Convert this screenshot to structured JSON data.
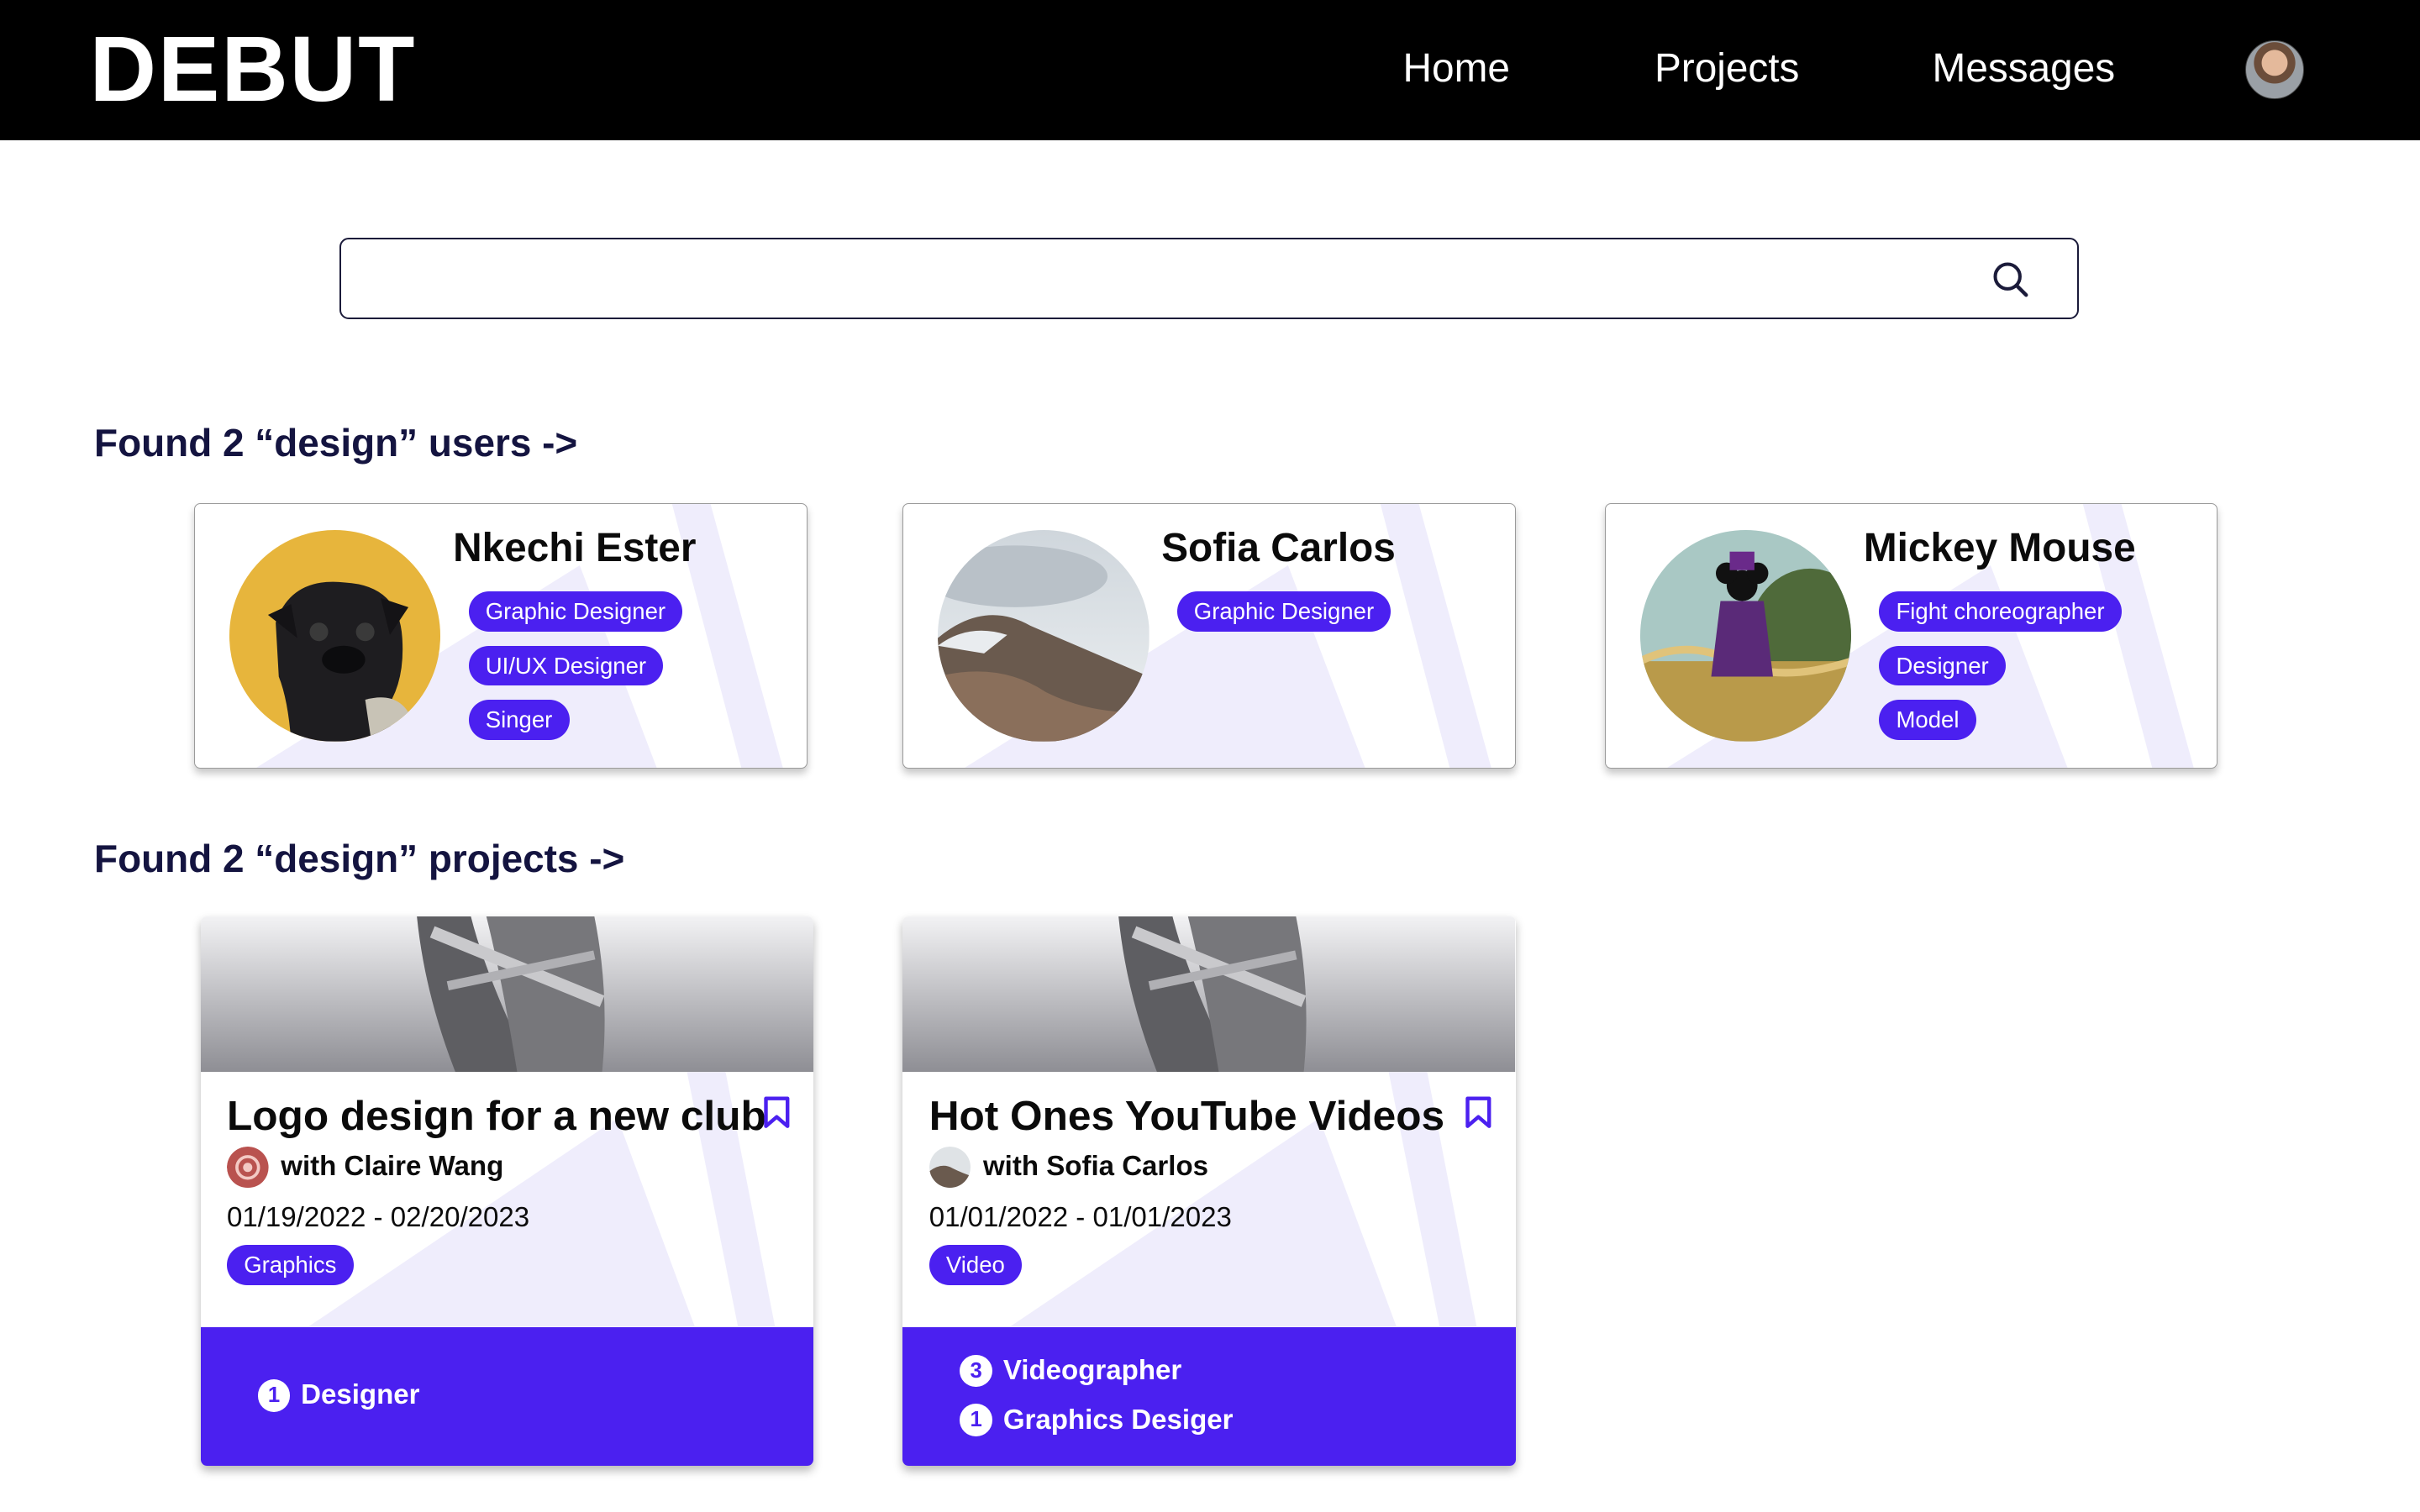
{
  "app": {
    "logo": "DEBUT"
  },
  "nav": {
    "home": "Home",
    "projects": "Projects",
    "messages": "Messages"
  },
  "search": {
    "value": "",
    "placeholder": ""
  },
  "users_section": {
    "title": "Found 2 “design” users ->"
  },
  "users": [
    {
      "name": "Nkechi Ester",
      "tags": [
        "Graphic Designer",
        "UI/UX Designer",
        "Singer"
      ]
    },
    {
      "name": "Sofia Carlos",
      "tags": [
        "Graphic Designer"
      ]
    },
    {
      "name": "Mickey Mouse",
      "tags": [
        "Fight choreographer",
        "Designer",
        "Model"
      ]
    }
  ],
  "projects_section": {
    "title": "Found 2 “design” projects ->"
  },
  "projects": [
    {
      "title": "Logo design for a new club",
      "collaborator": "with Claire Wang",
      "dates": "01/19/2022 - 02/20/2023",
      "tag": "Graphics",
      "roles": [
        {
          "count": "1",
          "label": "Designer"
        }
      ]
    },
    {
      "title": "Hot Ones YouTube Videos",
      "collaborator": "with Sofia Carlos",
      "dates": "01/01/2022 - 01/01/2023",
      "tag": "Video",
      "roles": [
        {
          "count": "3",
          "label": "Videographer"
        },
        {
          "count": "1",
          "label": "Graphics Desiger"
        }
      ]
    }
  ],
  "colors": {
    "accent": "#4b20f0",
    "header_bg": "#000000",
    "heading_text": "#141440"
  }
}
